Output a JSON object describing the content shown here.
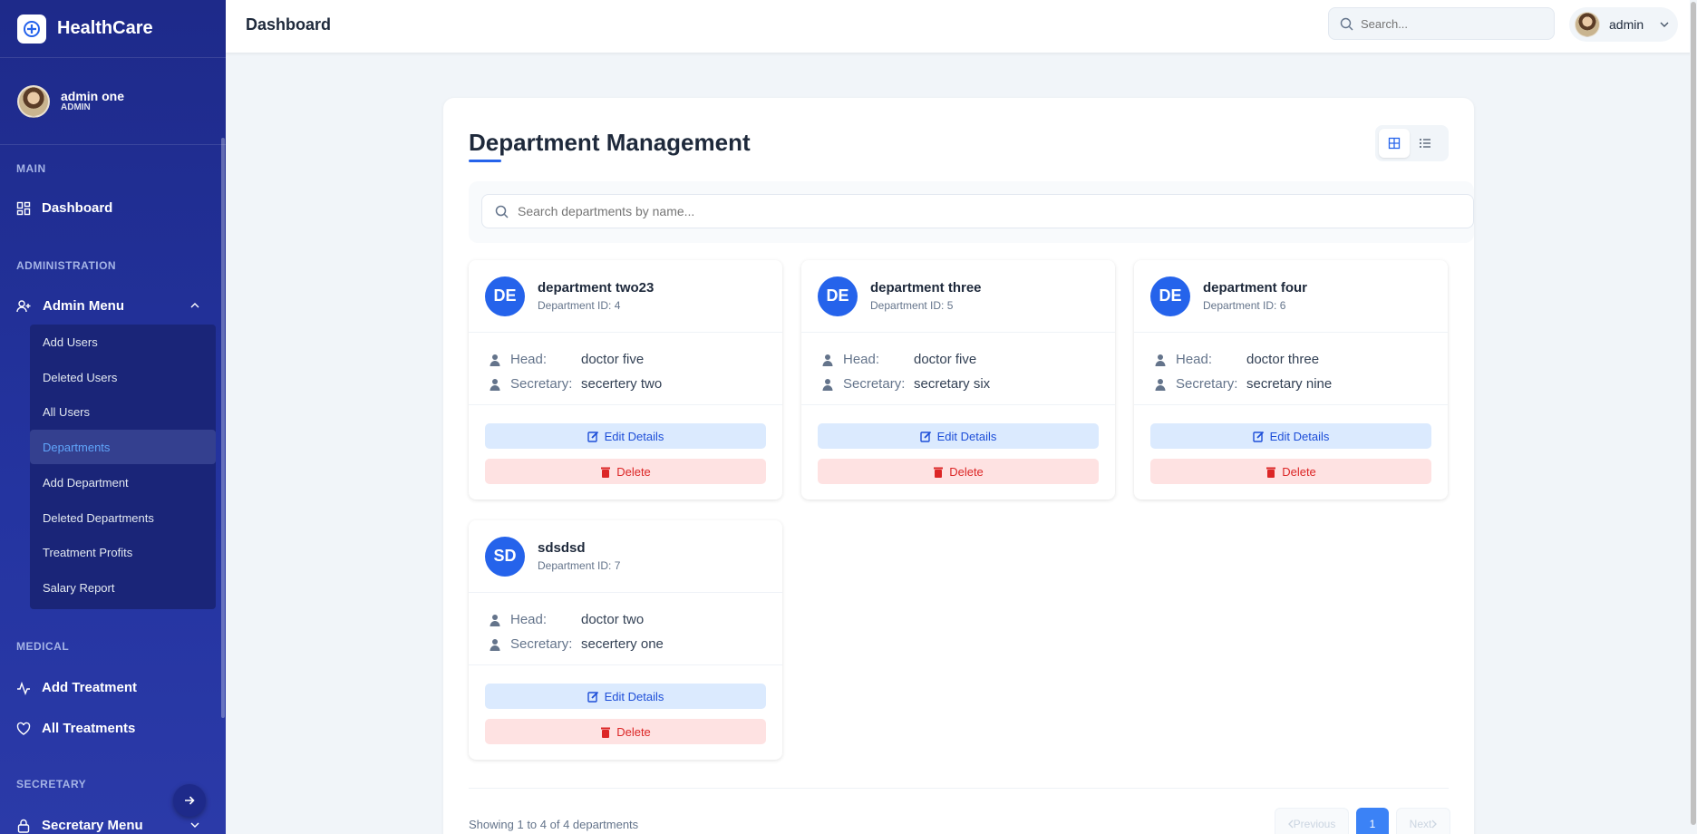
{
  "sidebar": {
    "brand": "HealthCare",
    "user": {
      "name": "admin one",
      "role": "ADMIN"
    },
    "sections": {
      "main": "MAIN",
      "administration": "ADMINISTRATION",
      "medical": "MEDICAL",
      "secretary": "SECRETARY"
    },
    "nav": {
      "dashboard": "Dashboard",
      "admin_menu": "Admin Menu",
      "add_treatment": "Add Treatment",
      "all_treatments": "All Treatments",
      "secretary_menu": "Secretary Menu"
    },
    "admin_items": [
      {
        "label": "Add Users"
      },
      {
        "label": "Deleted Users"
      },
      {
        "label": "All Users"
      },
      {
        "label": "Departments",
        "active": true
      },
      {
        "label": "Add Department"
      },
      {
        "label": "Deleted Departments"
      },
      {
        "label": "Treatment Profits"
      },
      {
        "label": "Salary Report"
      }
    ]
  },
  "topbar": {
    "title": "Dashboard",
    "search_placeholder": "Search...",
    "user_name": "admin"
  },
  "page": {
    "title": "Department Management",
    "search_placeholder": "Search departments by name...",
    "head_label": "Head:",
    "secretary_label": "Secretary:",
    "edit_label": "Edit Details",
    "delete_label": "Delete",
    "departments": [
      {
        "initials": "DE",
        "name": "department two23",
        "id_text": "Department ID: 4",
        "head": "doctor five",
        "secretary": "secertery two"
      },
      {
        "initials": "DE",
        "name": "department three",
        "id_text": "Department ID: 5",
        "head": "doctor five",
        "secretary": "secretary six"
      },
      {
        "initials": "DE",
        "name": "department four",
        "id_text": "Department ID: 6",
        "head": "doctor three",
        "secretary": "secretary nine"
      },
      {
        "initials": "SD",
        "name": "sdsdsd",
        "id_text": "Department ID: 7",
        "head": "doctor two",
        "secretary": "secertery one"
      }
    ],
    "showing_text": "Showing 1 to 4 of 4 departments",
    "pagination": {
      "prev": "Previous",
      "current": "1",
      "next": "Next"
    }
  },
  "colors": {
    "sidebar": "#1e2a8a",
    "accent": "#2563eb",
    "edit_bg": "#dbeafe",
    "delete_bg": "#fee2e2",
    "delete_text": "#dc2626"
  }
}
